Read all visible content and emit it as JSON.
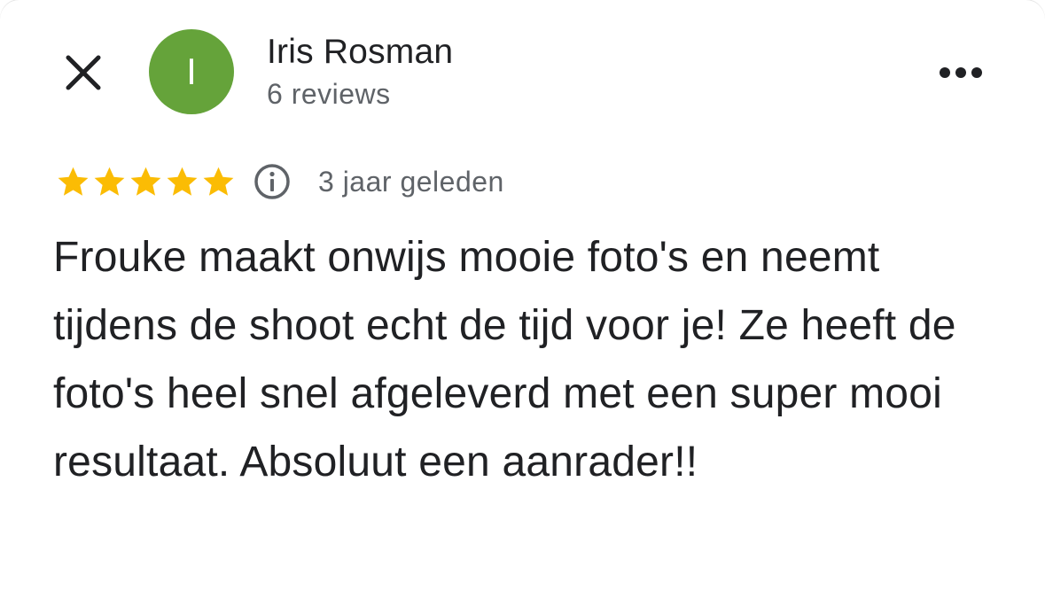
{
  "header": {
    "close_icon": "close-icon",
    "more_icon": "more-horizontal-icon"
  },
  "reviewer": {
    "initial": "I",
    "avatar_color": "#65a33a",
    "name": "Iris Rosman",
    "review_count": "6 reviews"
  },
  "rating": {
    "stars": 5,
    "max_stars": 5,
    "star_color": "#fbbc04",
    "info_icon": "info-icon",
    "time_ago": "3 jaar geleden"
  },
  "review": {
    "text": "Frouke maakt onwijs mooie foto's en neemt tijdens de shoot echt de tijd voor je! Ze heeft de foto's heel snel afgeleverd met een super mooi resultaat. Absoluut een aanrader!!"
  }
}
